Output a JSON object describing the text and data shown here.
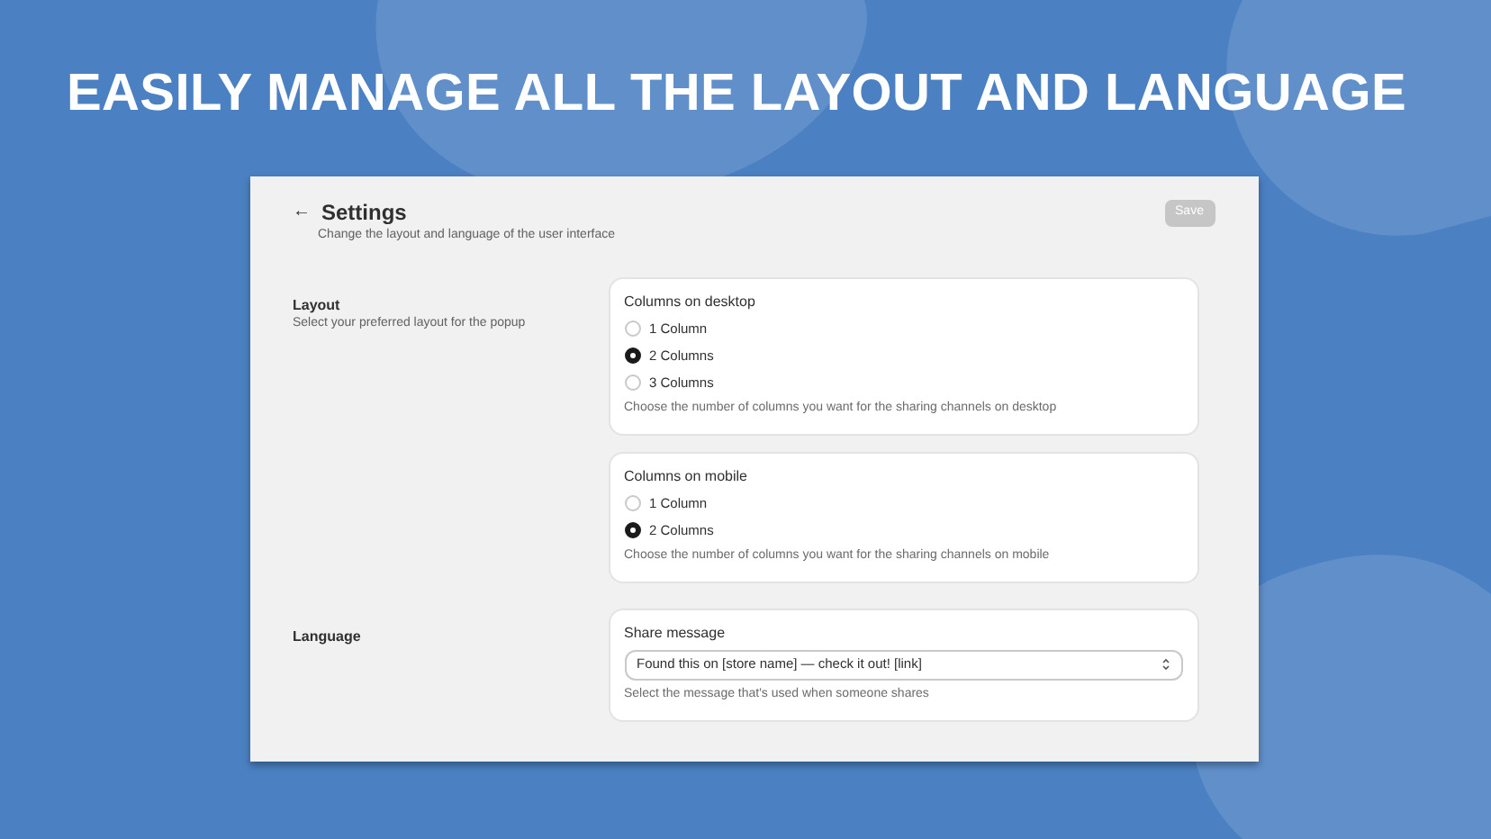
{
  "headline": "EASILY MANAGE ALL THE LAYOUT AND LANGUAGE",
  "header": {
    "back": "←",
    "title": "Settings",
    "subtitle": "Change the layout and language of the user interface",
    "save": {
      "label": "Save",
      "disabled": true
    }
  },
  "sections": [
    {
      "title": "Layout",
      "description": "Select your preferred layout for the popup",
      "cards": [
        {
          "kind": "radio",
          "label": "Columns on desktop",
          "options": [
            {
              "label": "1 Column",
              "selected": false
            },
            {
              "label": "2 Columns",
              "selected": true
            },
            {
              "label": "3 Columns",
              "selected": false
            }
          ],
          "help": "Choose the number of columns you want for the sharing channels on desktop"
        },
        {
          "kind": "radio",
          "label": "Columns on mobile",
          "options": [
            {
              "label": "1 Column",
              "selected": false
            },
            {
              "label": "2 Columns",
              "selected": true
            }
          ],
          "help": "Choose the number of columns you want for the sharing channels on mobile"
        }
      ]
    },
    {
      "title": "Language",
      "cards": [
        {
          "kind": "select",
          "label": "Share message",
          "value": "Found this on [store name] — check it out! [link]",
          "help": "Select the message that's used when someone shares"
        }
      ]
    }
  ]
}
